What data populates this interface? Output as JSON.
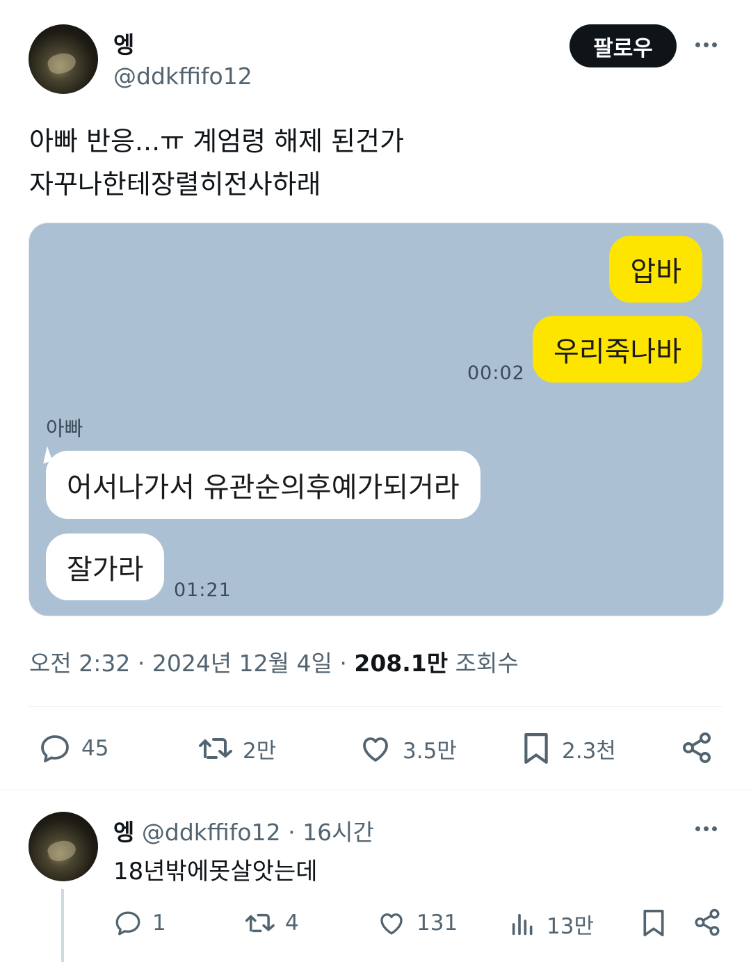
{
  "post": {
    "author_name": "엥",
    "handle": "@ddkffifo12",
    "follow_label": "팔로우",
    "text": "아빠 반응...ㅠ 계엄령 해제 된건가\n자꾸나한테장렬히전사하래",
    "meta": {
      "time": "오전 2:32",
      "sep1": "·",
      "date": "2024년 12월 4일",
      "sep2": "·",
      "views_count": "208.1만",
      "views_label": "조회수"
    },
    "actions": {
      "replies": "45",
      "reposts": "2만",
      "likes": "3.5만",
      "bookmarks": "2.3천"
    }
  },
  "chat": {
    "my_messages": [
      "압바",
      "우리죽나바"
    ],
    "my_time": "00:02",
    "sender_name": "아빠",
    "their_messages": [
      "어서나가서 유관순의후예가되거라",
      "잘가라"
    ],
    "their_time": "01:21",
    "colors": {
      "background": "#abc1d3",
      "my_bubble": "#fee500",
      "their_bubble": "#ffffff"
    }
  },
  "reply": {
    "author_name": "엥",
    "handle": "@ddkffifo12",
    "sep": "·",
    "age": "16시간",
    "text": "18년밖에못살앗는데",
    "actions": {
      "replies": "1",
      "reposts": "4",
      "likes": "131",
      "views": "13만"
    }
  },
  "icons": [
    "more-icon",
    "reply-icon",
    "repost-icon",
    "like-icon",
    "bookmark-icon",
    "share-icon",
    "views-icon"
  ]
}
